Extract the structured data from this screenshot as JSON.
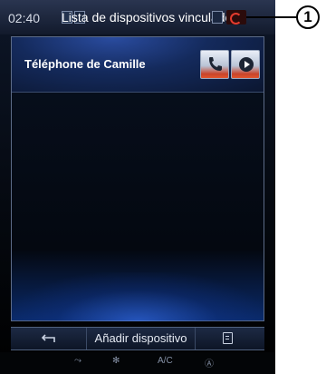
{
  "status_bar": {
    "time": "02:40",
    "title": "Lista de dispositivos vinculados"
  },
  "callout": {
    "number": "1"
  },
  "device_list": {
    "items": [
      {
        "name": "Téléphone de Camille",
        "actions": [
          "phone-icon",
          "play-icon"
        ]
      }
    ]
  },
  "action_bar": {
    "back_icon": "back-arrow-icon",
    "add_label": "Añadir dispositivo",
    "menu_icon": "menu-icon"
  },
  "climate_bar": {
    "items": [
      "air-flow-icon",
      "fan-icon",
      "A/C",
      "auto-icon"
    ]
  },
  "colors": {
    "accent_red": "#e0562e",
    "panel_border": "#5c6b87",
    "glow_blue": "#3c78ff"
  }
}
